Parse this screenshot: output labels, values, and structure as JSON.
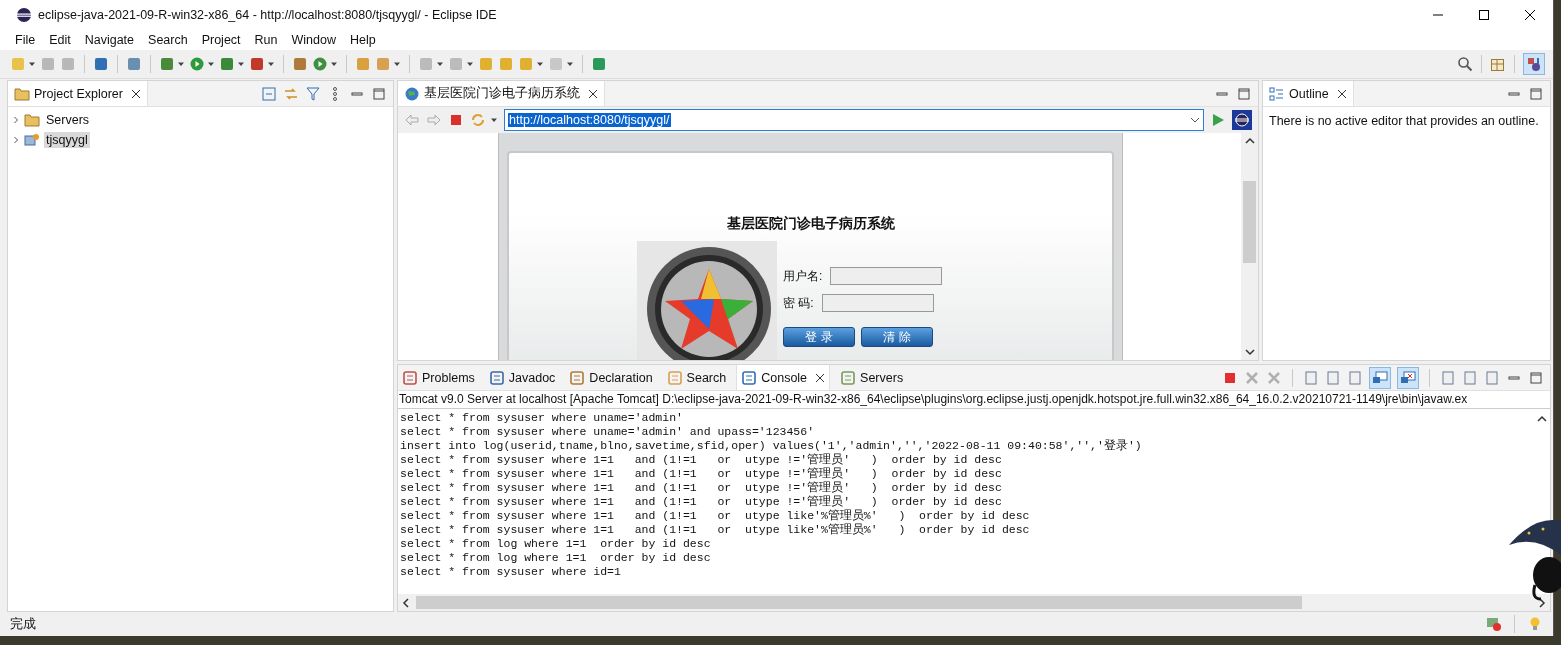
{
  "window": {
    "title": "eclipse-java-2021-09-R-win32-x86_64 - http://localhost:8080/tjsqyygl/ - Eclipse IDE"
  },
  "menu": [
    {
      "label": "File"
    },
    {
      "label": "Edit"
    },
    {
      "label": "Navigate"
    },
    {
      "label": "Search"
    },
    {
      "label": "Project"
    },
    {
      "label": "Run"
    },
    {
      "label": "Window"
    },
    {
      "label": "Help"
    }
  ],
  "toolbar": {
    "java_perspective_selected": true
  },
  "project_explorer": {
    "title": "Project Explorer",
    "items": [
      {
        "label": "Servers",
        "expanded": false,
        "selected": false
      },
      {
        "label": "tjsqyygl",
        "expanded": false,
        "selected": true
      }
    ]
  },
  "browser": {
    "tab_title": "基层医院门诊电子病历系统",
    "url": "http://localhost:8080/tjsqyygl/",
    "page": {
      "title": "基层医院门诊电子病历系统",
      "username_label": "用户名:",
      "password_label": "密 码:",
      "buttons": [
        "登 录",
        "清 除"
      ]
    }
  },
  "outline": {
    "title": "Outline",
    "message": "There is no active editor that provides an outline."
  },
  "console": {
    "tabs": [
      {
        "label": "Problems",
        "selected": false
      },
      {
        "label": "Javadoc",
        "selected": false
      },
      {
        "label": "Declaration",
        "selected": false
      },
      {
        "label": "Search",
        "selected": false
      },
      {
        "label": "Console",
        "selected": true
      },
      {
        "label": "Servers",
        "selected": false
      }
    ],
    "show_on_output_pressed": true,
    "show_on_error_pressed": true,
    "header": "Tomcat v9.0 Server at localhost [Apache Tomcat] D:\\eclipse-java-2021-09-R-win32-x86_64\\eclipse\\plugins\\org.eclipse.justj.openjdk.hotspot.jre.full.win32.x86_64_16.0.2.v20210721-1149\\jre\\bin\\javaw.ex",
    "lines": [
      "select * from sysuser where uname='admin'",
      "select * from sysuser where uname='admin' and upass='123456'",
      "insert into log(userid,tname,blno,savetime,sfid,oper) values('1','admin','','2022-08-11 09:40:58','','登录')",
      "select * from sysuser where 1=1   and (1!=1   or  utype !='管理员'   )  order by id desc",
      "select * from sysuser where 1=1   and (1!=1   or  utype !='管理员'   )  order by id desc",
      "select * from sysuser where 1=1   and (1!=1   or  utype !='管理员'   )  order by id desc",
      "select * from sysuser where 1=1   and (1!=1   or  utype !='管理员'   )  order by id desc",
      "select * from sysuser where 1=1   and (1!=1   or  utype like'%管理员%'   )  order by id desc",
      "select * from sysuser where 1=1   and (1!=1   or  utype like'%管理员%'   )  order by id desc",
      "select * from log where 1=1  order by id desc",
      "select * from log where 1=1  order by id desc",
      "select * from sysuser where id=1"
    ]
  },
  "status_bar": {
    "text": "完成"
  }
}
